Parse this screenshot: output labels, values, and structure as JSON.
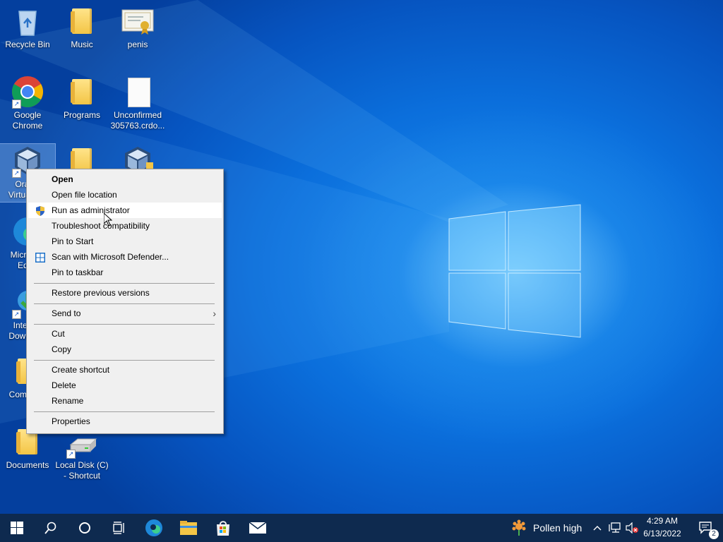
{
  "desktop": {
    "icons": [
      {
        "label": "Recycle Bin"
      },
      {
        "label": "Music"
      },
      {
        "label": "penis"
      },
      {
        "label": "Google Chrome"
      },
      {
        "label": "Programs"
      },
      {
        "label": "Unconfirmed 305763.crdo..."
      },
      {
        "label": "Oracle VirtualBox"
      },
      {
        "label": "Microsoft Edge"
      },
      {
        "label": "Internet Download Manager"
      },
      {
        "label": "Computer"
      },
      {
        "label": "Documents"
      },
      {
        "label": "Local Disk (C) - Shortcut"
      }
    ]
  },
  "context_menu": {
    "items": {
      "open": "Open",
      "open_file_location": "Open file location",
      "run_as_admin": "Run as administrator",
      "troubleshoot": "Troubleshoot compatibility",
      "pin_start": "Pin to Start",
      "scan_defender": "Scan with Microsoft Defender...",
      "pin_taskbar": "Pin to taskbar",
      "restore_versions": "Restore previous versions",
      "send_to": "Send to",
      "cut": "Cut",
      "copy": "Copy",
      "create_shortcut": "Create shortcut",
      "delete": "Delete",
      "rename": "Rename",
      "properties": "Properties"
    }
  },
  "taskbar": {
    "weather": "Pollen high",
    "time": "4:29 AM",
    "date": "6/13/2022",
    "notification_count": "2"
  },
  "colors": {
    "taskbar": "#0e2a4f",
    "wallpaper": "#0b6fdc",
    "menu_bg": "#f0f0f0"
  }
}
